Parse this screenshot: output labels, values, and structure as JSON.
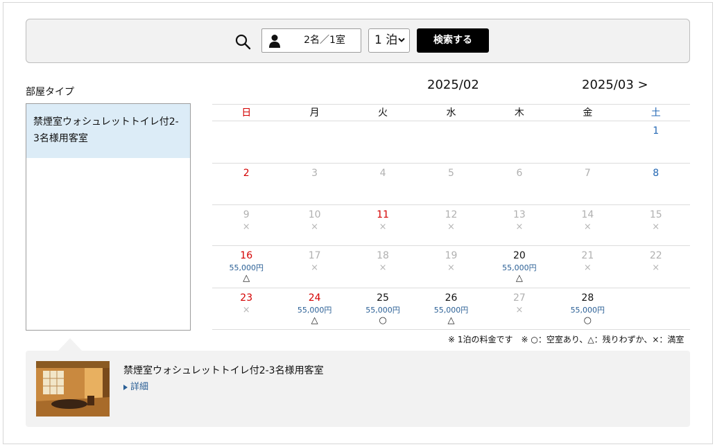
{
  "search": {
    "guests": "2名／1室",
    "nights": "1 泊",
    "button": "検索する"
  },
  "rooms": {
    "label": "部屋タイプ",
    "items": [
      {
        "name": "禁煙室ウォシュレットトイレ付2-3名様用客室"
      }
    ]
  },
  "calendar": {
    "current_month": "2025/02",
    "next_month": "2025/03 >",
    "weekdays": [
      "日",
      "月",
      "火",
      "水",
      "木",
      "金",
      "土"
    ],
    "weeks": [
      [
        {
          "day": "",
          "price": "",
          "mark": "",
          "style": ""
        },
        {
          "day": "",
          "price": "",
          "mark": "",
          "style": ""
        },
        {
          "day": "",
          "price": "",
          "mark": "",
          "style": ""
        },
        {
          "day": "",
          "price": "",
          "mark": "",
          "style": ""
        },
        {
          "day": "",
          "price": "",
          "mark": "",
          "style": ""
        },
        {
          "day": "",
          "price": "",
          "mark": "",
          "style": ""
        },
        {
          "day": "1",
          "price": "",
          "mark": "",
          "style": "blue"
        }
      ],
      [
        {
          "day": "2",
          "price": "",
          "mark": "",
          "style": "red"
        },
        {
          "day": "3",
          "price": "",
          "mark": "",
          "style": "gray"
        },
        {
          "day": "4",
          "price": "",
          "mark": "",
          "style": "gray"
        },
        {
          "day": "5",
          "price": "",
          "mark": "",
          "style": "gray"
        },
        {
          "day": "6",
          "price": "",
          "mark": "",
          "style": "gray"
        },
        {
          "day": "7",
          "price": "",
          "mark": "",
          "style": "gray"
        },
        {
          "day": "8",
          "price": "",
          "mark": "",
          "style": "blue"
        }
      ],
      [
        {
          "day": "9",
          "price": "",
          "mark": "×",
          "style": "gray"
        },
        {
          "day": "10",
          "price": "",
          "mark": "×",
          "style": "gray"
        },
        {
          "day": "11",
          "price": "",
          "mark": "×",
          "style": "red"
        },
        {
          "day": "12",
          "price": "",
          "mark": "×",
          "style": "gray"
        },
        {
          "day": "13",
          "price": "",
          "mark": "×",
          "style": "gray"
        },
        {
          "day": "14",
          "price": "",
          "mark": "×",
          "style": "gray"
        },
        {
          "day": "15",
          "price": "",
          "mark": "×",
          "style": "gray"
        }
      ],
      [
        {
          "day": "16",
          "price": "55,000円",
          "mark": "△",
          "style": "red"
        },
        {
          "day": "17",
          "price": "",
          "mark": "×",
          "style": "gray"
        },
        {
          "day": "18",
          "price": "",
          "mark": "×",
          "style": "gray"
        },
        {
          "day": "19",
          "price": "",
          "mark": "×",
          "style": "gray"
        },
        {
          "day": "20",
          "price": "55,000円",
          "mark": "△",
          "style": "blk"
        },
        {
          "day": "21",
          "price": "",
          "mark": "×",
          "style": "gray"
        },
        {
          "day": "22",
          "price": "",
          "mark": "×",
          "style": "gray"
        }
      ],
      [
        {
          "day": "23",
          "price": "",
          "mark": "×",
          "style": "red"
        },
        {
          "day": "24",
          "price": "55,000円",
          "mark": "△",
          "style": "red"
        },
        {
          "day": "25",
          "price": "55,000円",
          "mark": "○",
          "style": "blk"
        },
        {
          "day": "26",
          "price": "55,000円",
          "mark": "△",
          "style": "blk"
        },
        {
          "day": "27",
          "price": "",
          "mark": "×",
          "style": "gray"
        },
        {
          "day": "28",
          "price": "55,000円",
          "mark": "○",
          "style": "blk"
        },
        {
          "day": "",
          "price": "",
          "mark": "",
          "style": ""
        }
      ]
    ],
    "legend": "※ 1泊の料金です　※ ○：空室あり、△：残りわずか、×：満室"
  },
  "detail": {
    "room_name": "禁煙室ウォシュレットトイレ付2-3名様用客室",
    "link": "詳細"
  },
  "colors": {
    "sunday": "#d40000",
    "saturday": "#2468b4",
    "price": "#2a5f95",
    "selected_room": "#dcecf7"
  }
}
